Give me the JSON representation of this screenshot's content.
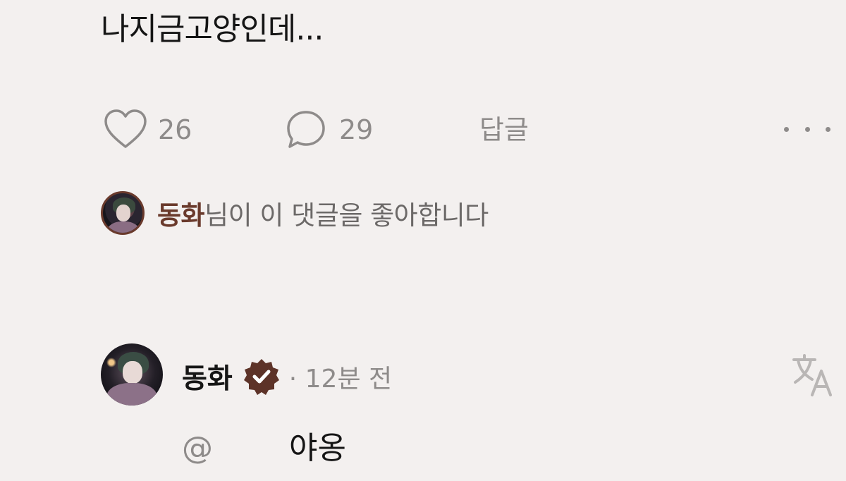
{
  "comment": {
    "text": "나지금고양인데..."
  },
  "actions": {
    "like_count": "26",
    "reply_count": "29",
    "reply_label": "답글"
  },
  "liked_by": {
    "name": "동화",
    "suffix": "님이 이 댓글을 좋아합니다"
  },
  "reply": {
    "author": "동화",
    "time": "· 12분 전",
    "mention": "@",
    "text": "야옹"
  },
  "icons": {
    "like": "heart-icon",
    "comment": "speech-bubble-icon",
    "more": "more-dots-icon",
    "verified": "verified-badge-icon",
    "translate": "translate-icon"
  },
  "colors": {
    "background": "#f3f0ef",
    "text": "#151515",
    "muted": "#8e8b8a",
    "accent": "#6a3a2c"
  }
}
